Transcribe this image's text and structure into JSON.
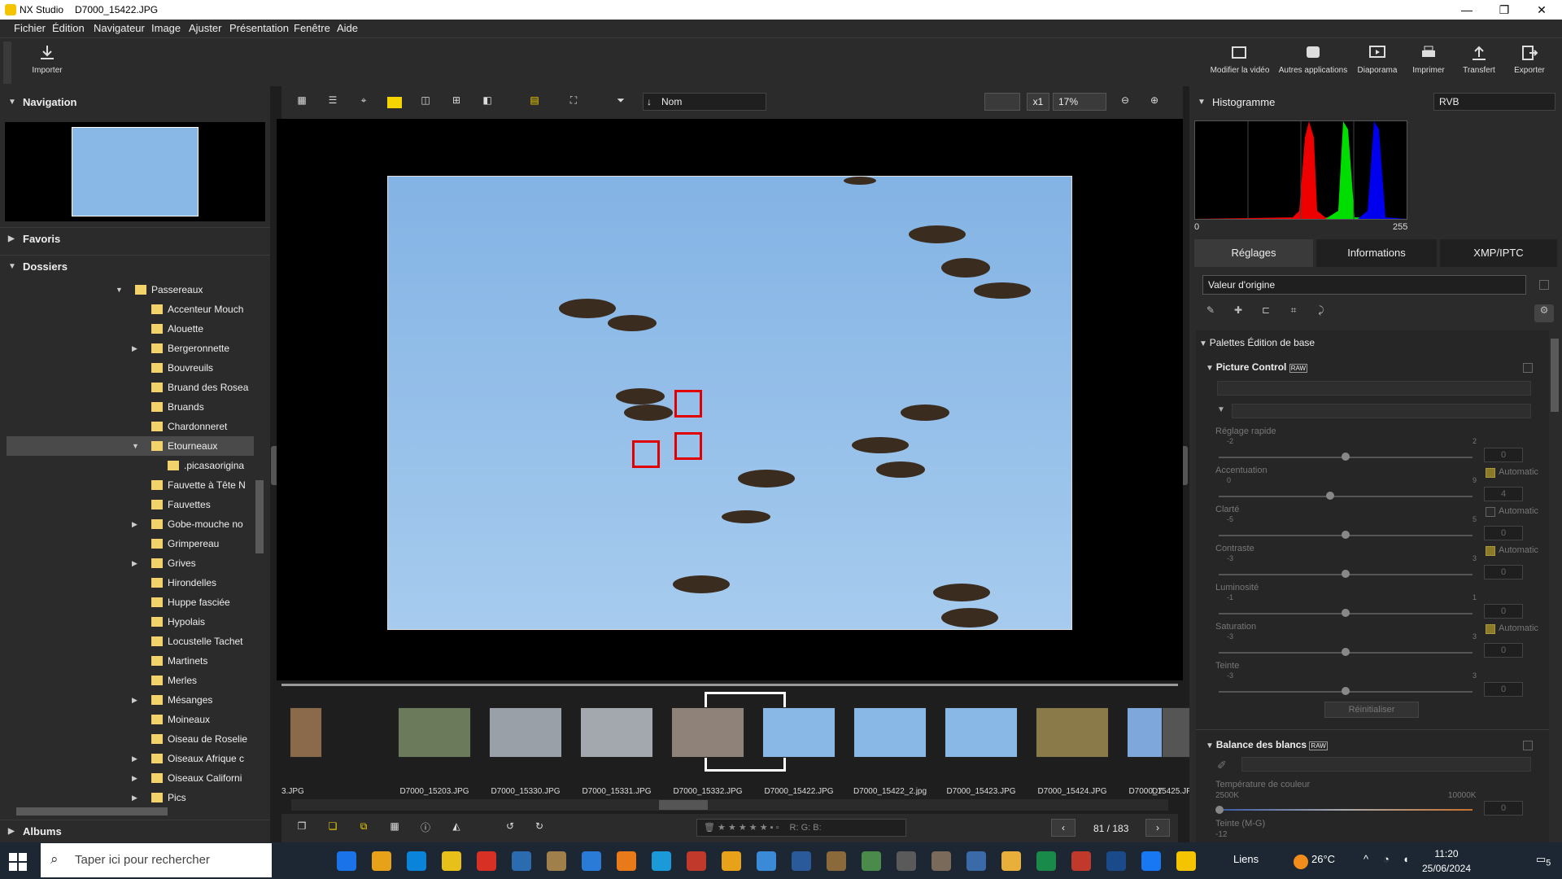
{
  "window": {
    "app_name": "NX Studio",
    "file_name": "D7000_15422.JPG"
  },
  "menu": [
    "Fichier",
    "Édition",
    "Navigateur",
    "Image",
    "Ajuster",
    "Présentation",
    "Fenêtre",
    "Aide"
  ],
  "toolbar": {
    "import_label": "Importer",
    "right_actions": [
      "Modifier la vidéo",
      "Autres applications",
      "Diaporama",
      "Imprimer",
      "Transfert",
      "Exporter"
    ]
  },
  "left_panel": {
    "navigation_title": "Navigation",
    "favorites_title": "Favoris",
    "folders_title": "Dossiers",
    "albums_title": "Albums",
    "folders": [
      {
        "label": "Passereaux",
        "level": 0,
        "expander": "▼"
      },
      {
        "label": "Accenteur Mouch",
        "level": 1,
        "expander": ""
      },
      {
        "label": "Alouette",
        "level": 1,
        "expander": ""
      },
      {
        "label": "Bergeronnette",
        "level": 1,
        "expander": "▶"
      },
      {
        "label": "Bouvreuils",
        "level": 1,
        "expander": ""
      },
      {
        "label": "Bruand des Rosea",
        "level": 1,
        "expander": ""
      },
      {
        "label": "Bruands",
        "level": 1,
        "expander": ""
      },
      {
        "label": "Chardonneret",
        "level": 1,
        "expander": ""
      },
      {
        "label": "Etourneaux",
        "level": 1,
        "expander": "▼",
        "selected": true
      },
      {
        "label": ".picasaorigina",
        "level": 2,
        "expander": ""
      },
      {
        "label": "Fauvette à Tête N",
        "level": 1,
        "expander": ""
      },
      {
        "label": "Fauvettes",
        "level": 1,
        "expander": ""
      },
      {
        "label": "Gobe-mouche no",
        "level": 1,
        "expander": "▶"
      },
      {
        "label": "Grimpereau",
        "level": 1,
        "expander": ""
      },
      {
        "label": "Grives",
        "level": 1,
        "expander": "▶"
      },
      {
        "label": "Hirondelles",
        "level": 1,
        "expander": ""
      },
      {
        "label": "Huppe fasciée",
        "level": 1,
        "expander": ""
      },
      {
        "label": "Hypolais",
        "level": 1,
        "expander": ""
      },
      {
        "label": "Locustelle Tachet",
        "level": 1,
        "expander": ""
      },
      {
        "label": "Martinets",
        "level": 1,
        "expander": ""
      },
      {
        "label": "Merles",
        "level": 1,
        "expander": ""
      },
      {
        "label": "Mésanges",
        "level": 1,
        "expander": "▶"
      },
      {
        "label": "Moineaux",
        "level": 1,
        "expander": ""
      },
      {
        "label": "Oiseau de Roselie",
        "level": 1,
        "expander": ""
      },
      {
        "label": "Oiseaux Afrique c",
        "level": 1,
        "expander": "▶"
      },
      {
        "label": "Oiseaux Californi",
        "level": 1,
        "expander": "▶"
      },
      {
        "label": "Pics",
        "level": 1,
        "expander": "▶"
      }
    ]
  },
  "viewbar": {
    "sort_label": "Nom",
    "zoom_mult": "x1",
    "zoom_percent": "17%"
  },
  "filmstrip": {
    "items": [
      {
        "caption": "3.JPG",
        "color": "#8a6a4a"
      },
      {
        "caption": "D7000_15203.JPG",
        "color": "#6b7a5a"
      },
      {
        "caption": "D7000_15330.JPG",
        "color": "#9aa0a8"
      },
      {
        "caption": "D7000_15331.JPG",
        "color": "#a3a8ae"
      },
      {
        "caption": "D7000_15332.JPG",
        "color": "#8f8278"
      },
      {
        "caption": "D7000_15422.JPG",
        "color": "#8ab8e6",
        "selected": true
      },
      {
        "caption": "D7000_15422_2.jpg",
        "color": "#8ab8e6"
      },
      {
        "caption": "D7000_15423.JPG",
        "color": "#8ab8e6"
      },
      {
        "caption": "D7000_15424.JPG",
        "color": "#8a7a4a"
      },
      {
        "caption": "D7000_15425.JPG",
        "color": "#7ea8dc"
      },
      {
        "caption": "D7",
        "color": "#555555"
      }
    ]
  },
  "bottombar": {
    "rgb_readout": "R:    G:    B:",
    "page_counter": "81 / 183"
  },
  "right_panel": {
    "histogram_title": "Histogramme",
    "channel": "RVB",
    "histo_min": "0",
    "histo_max": "255",
    "tabs": [
      "Réglages",
      "Informations",
      "XMP/IPTC"
    ],
    "preset": "Valeur d'origine",
    "basic_palettes": "Palettes Édition de base",
    "picture_control_title": "Picture Control",
    "raw_badge": "RAW",
    "sliders": [
      {
        "label": "Réglage rapide",
        "min": "-2",
        "max": "2",
        "value": "0",
        "pos": 0.5,
        "auto": null
      },
      {
        "label": "Accentuation",
        "min": "0",
        "max": "9",
        "value": "4",
        "pos": 0.44,
        "auto": true
      },
      {
        "label": "Clarté",
        "min": "-5",
        "max": "5",
        "value": "0",
        "pos": 0.5,
        "auto": false
      },
      {
        "label": "Contraste",
        "min": "-3",
        "max": "3",
        "value": "0",
        "pos": 0.5,
        "auto": true
      },
      {
        "label": "Luminosité",
        "min": "-1",
        "max": "1",
        "value": "0",
        "pos": 0.5,
        "auto": null
      },
      {
        "label": "Saturation",
        "min": "-3",
        "max": "3",
        "value": "0",
        "pos": 0.5,
        "auto": true
      },
      {
        "label": "Teinte",
        "min": "-3",
        "max": "3",
        "value": "0",
        "pos": 0.5,
        "auto": null
      }
    ],
    "auto_label": "Automatic",
    "reset_label": "Réinitialiser",
    "wb_title": "Balance des blancs",
    "temp_label": "Température de couleur",
    "temp_min": "2500K",
    "temp_max": "10000K",
    "temp_value": "0",
    "tint_label": "Teinte (M-G)",
    "tint_min": "-12"
  },
  "taskbar": {
    "search_placeholder": "Taper ici pour rechercher",
    "links_label": "Liens",
    "weather": "26°C",
    "time": "11:20",
    "date": "25/06/2024",
    "notif_count": "5",
    "apps": [
      "#1a73e8",
      "#e8a21a",
      "#0a84d8",
      "#e8c01a",
      "#d93025",
      "#2b6cb0",
      "#a0804a",
      "#2a7ad8",
      "#e87a1a",
      "#1a9ad8",
      "#c0392b",
      "#e8a21a",
      "#3a8ad8",
      "#2a5a9a",
      "#8a6a3a",
      "#4a8a4a",
      "#5a5a5a",
      "#7a6a5a",
      "#3a6aa8",
      "#e8b03a",
      "#1a8a4a",
      "#c0392b",
      "#1a4a8a",
      "#1877f2",
      "#f5c400"
    ]
  }
}
